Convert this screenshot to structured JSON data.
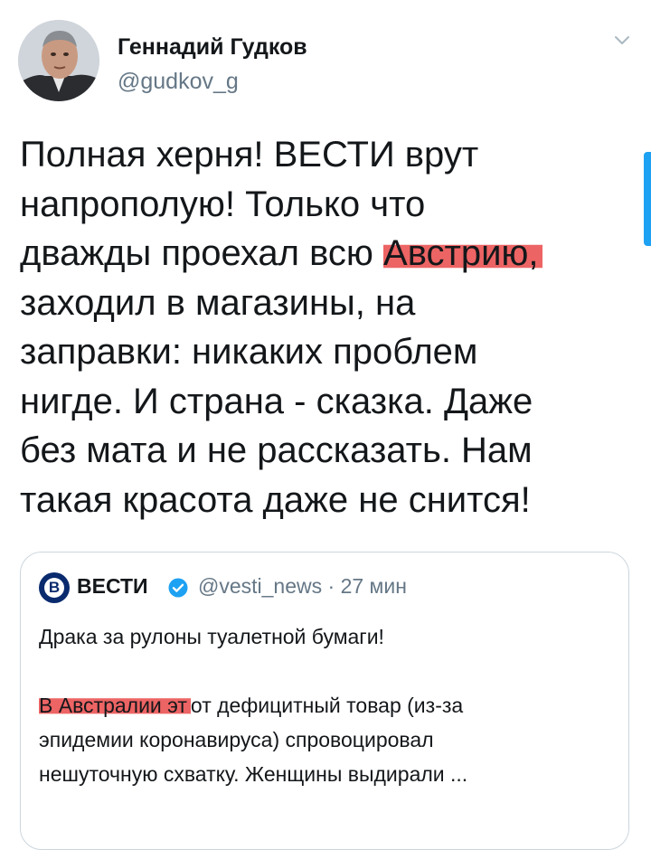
{
  "author": {
    "name": "Геннадий Гудков",
    "handle": "@gudkov_g"
  },
  "icons": {
    "more": "chevron-down-icon",
    "verified": "verified-badge-icon",
    "logo": "vesti-logo-icon"
  },
  "colors": {
    "accent": "#1da1f2",
    "highlight": "#e62828",
    "secondary_text": "#657786",
    "border": "#ccd6dd"
  },
  "tweet": {
    "lines": [
      "Полная херня! ВЕСТИ врут",
      "напрополую! Только что",
      "дважды проехал всю ",
      "заходил в магазины, на",
      "заправки: никаких проблем",
      "нигде. И страна - сказка. Даже",
      "без мата и не рассказать. Нам",
      "такая красота даже не снится!"
    ],
    "highlighted_word": "Австрию,"
  },
  "quoted": {
    "logo_letter": "В",
    "name": "ВЕСТИ",
    "meta": "@vesti_news · 27 мин",
    "title": "Драка за рулоны туалетной бумаги!",
    "body_line1_highlight": "В Австралии эт",
    "body_line1_rest": "от дефицитный товар (из-за",
    "body_line2": "эпидемии коронавируса) спровоцировал",
    "body_line3": "нешуточную схватку. Женщины выдирали ..."
  }
}
